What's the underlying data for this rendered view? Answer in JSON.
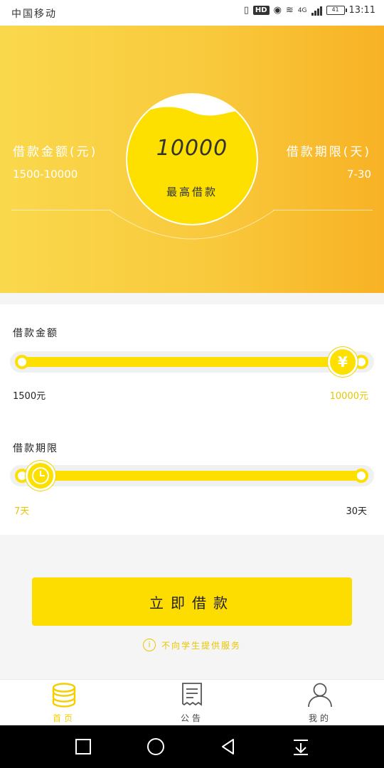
{
  "status": {
    "carrier": "中国移动",
    "network": "4G",
    "battery": "41",
    "time": "13:11"
  },
  "hero": {
    "left_label": "借款金额(元)",
    "left_value": "1500-10000",
    "right_label": "借款期限(天)",
    "right_value": "7-30",
    "max_amount": "10000",
    "max_label": "最高借款"
  },
  "amount_slider": {
    "title": "借款金额",
    "min_label": "1500元",
    "max_label": "10000元",
    "thumb_symbol": "¥",
    "level": 1.0
  },
  "term_slider": {
    "title": "借款期限",
    "min_label": "7天",
    "max_label": "30天",
    "level": 0.0
  },
  "cta": {
    "label": "立即借款",
    "notice": "不向学生提供服务",
    "notice_icon": "i"
  },
  "bottom_nav": {
    "items": [
      {
        "label": "首页",
        "icon": "coins-icon",
        "active": true
      },
      {
        "label": "公告",
        "icon": "document-icon",
        "active": false
      },
      {
        "label": "我的",
        "icon": "user-icon",
        "active": false
      }
    ]
  },
  "colors": {
    "accent": "#fddc00",
    "hero_start": "#fad84c",
    "hero_end": "#f8b225"
  }
}
